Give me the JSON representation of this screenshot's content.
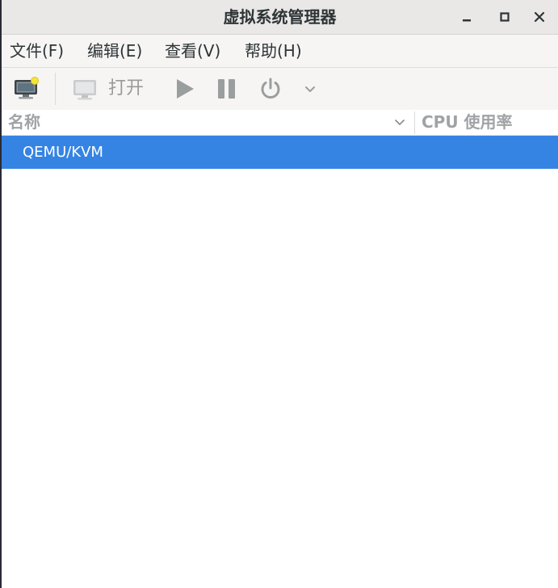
{
  "window": {
    "title": "虚拟系统管理器"
  },
  "menubar": {
    "items": [
      {
        "label": "文件(F)"
      },
      {
        "label": "编辑(E)"
      },
      {
        "label": "查看(V)"
      },
      {
        "label": "帮助(H)"
      }
    ]
  },
  "toolbar": {
    "open_label": "打开",
    "icons": [
      "new-vm-icon",
      "monitor-icon",
      "play-icon",
      "pause-icon",
      "power-icon",
      "chevron-down-icon"
    ]
  },
  "columns": {
    "name": "名称",
    "cpu": "CPU 使用率"
  },
  "connections": [
    {
      "label": "QEMU/KVM",
      "selected": true
    }
  ],
  "colors": {
    "selection": "#3584e4",
    "titlebar": "#e9e8e6",
    "toolbar": "#f6f5f4"
  }
}
